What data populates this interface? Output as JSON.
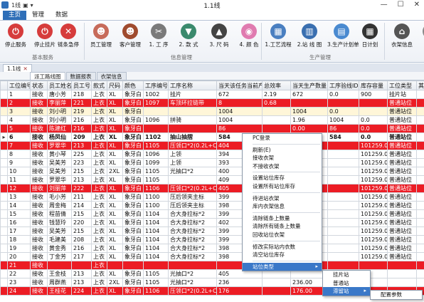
{
  "titlebar": {
    "qa_icon_text": "1线",
    "title": "1.1线",
    "minimize": "—",
    "maximize": "☐",
    "close": "✕"
  },
  "ribbon_tabs": [
    "主页",
    "管理",
    "数据"
  ],
  "ribbon": {
    "groups": {
      "basic": "基本服务",
      "info": "信息管理",
      "production": "生产管理"
    },
    "buttons": [
      {
        "label": "停止服务",
        "icon": "stop-service-icon",
        "color": "#d63c3c",
        "glyph": "⏻"
      },
      {
        "label": "停止挂片",
        "icon": "stop-hanging-icon",
        "color": "#d63c3c",
        "glyph": "⏻"
      },
      {
        "label": "链条急停",
        "icon": "chain-stop-icon",
        "color": "#d63c3c",
        "glyph": "✕"
      },
      {
        "label": "员工管理",
        "icon": "staff-icon",
        "color": "#c76b5a",
        "glyph": "☻"
      },
      {
        "label": "客户管理",
        "icon": "customer-icon",
        "color": "#a04b2e",
        "glyph": "☻"
      },
      {
        "label": "1. 工 序",
        "icon": "process-scissors-icon",
        "color": "#7a7a7a",
        "glyph": "✂"
      },
      {
        "label": "2. 款 式",
        "icon": "style-shirt-icon",
        "color": "#3b8a6d",
        "glyph": "▼"
      },
      {
        "label": "3. 尺 码",
        "icon": "size-icon",
        "color": "#444444",
        "glyph": "▲"
      },
      {
        "label": "4. 颜 色",
        "icon": "color-palette-icon",
        "color": "#e07bb0",
        "glyph": "◉"
      },
      {
        "label": "1.工艺流程",
        "icon": "workflow-icon",
        "color": "#4a7fc1",
        "glyph": "▦"
      },
      {
        "label": "2.站 线 图",
        "icon": "station-map-icon",
        "color": "#3a6fb0",
        "glyph": "▥"
      },
      {
        "label": "3.生产计划单",
        "icon": "plan-icon",
        "color": "#4a8ad0",
        "glyph": "▤"
      },
      {
        "label": "日计划",
        "icon": "calendar-icon",
        "color": "#333333",
        "glyph": "▦"
      },
      {
        "label": "衣架信息",
        "icon": "hanger-icon",
        "color": "#555555",
        "glyph": "⌂"
      },
      {
        "label": "数",
        "icon": "data-icon",
        "color": "#888888",
        "glyph": "▣"
      }
    ]
  },
  "doc_tabs": [
    {
      "label": "1.1线",
      "close": "✕"
    }
  ],
  "sub_tabs": [
    "派工路线图",
    "数据报表",
    "衣架信息"
  ],
  "grid": {
    "columns": [
      "工位编号",
      "状态",
      "员工姓名",
      "员工号",
      "款式",
      "尺码",
      "颜色",
      "工序编号",
      "工序名称",
      "当天该任务当前产量",
      "总效率",
      "当天生产数量",
      "工序验线ID",
      "库存容量",
      "工位类型",
      "其他"
    ],
    "rows": [
      {
        "style": "r-white",
        "ind": "",
        "cells": [
          "1",
          "接收",
          "唐小芳",
          "218",
          "上衣",
          "XL",
          "象牙白",
          "1002",
          "挂片",
          "672",
          "2.19",
          "672",
          "0.0",
          "900",
          "挂片站",
          ""
        ]
      },
      {
        "style": "r-red",
        "ind": "",
        "cells": [
          "2",
          "接收",
          "李丽萍",
          "221",
          "上衣",
          "XL",
          "象牙白",
          "1097",
          "车顶环拉链带",
          "8",
          "0.68",
          "",
          "",
          "",
          "普通站位",
          ""
        ]
      },
      {
        "style": "r-yellow",
        "ind": "",
        "cells": [
          "3",
          "接收",
          "刘小明",
          "219",
          "上衣",
          "XL",
          "象牙白",
          "",
          "",
          "1004",
          "",
          "1004",
          "0.0",
          "",
          "普通站位",
          ""
        ]
      },
      {
        "style": "r-white",
        "ind": "",
        "cells": [
          "4",
          "接收",
          "刘小明",
          "216",
          "上衣",
          "XL",
          "象牙白",
          "1096",
          "拼骑",
          "1004",
          "",
          "1.96",
          "1004",
          "0.0",
          "普通站位",
          ""
        ]
      },
      {
        "style": "r-red",
        "ind": "",
        "cells": [
          "5",
          "接收",
          "陈建红",
          "216",
          "上衣",
          "XL",
          "象牙白",
          "",
          "",
          "86",
          "",
          "0.00",
          "86",
          "0.0",
          "普通站位",
          ""
        ]
      },
      {
        "style": "r-sel",
        "ind": "▸",
        "cells": [
          "6",
          "接收",
          "杨凤仙",
          "209",
          "上衣",
          "XL",
          "象牙白",
          "1102",
          "抽山抽摺",
          "584",
          "",
          "2.04",
          "584",
          "0.0",
          "普通站位",
          ""
        ]
      },
      {
        "style": "r-red",
        "ind": "",
        "cells": [
          "7",
          "接收",
          "罗翠华",
          "213",
          "上衣",
          "XL",
          "象牙白",
          "1105",
          "压领口*2(0.2L+C)",
          "404",
          "",
          "",
          "",
          "101259.0",
          "普通站位",
          ""
        ]
      },
      {
        "style": "r-white",
        "ind": "",
        "cells": [
          "8",
          "接收",
          "黄小琴",
          "225",
          "上衣",
          "XL",
          "象牙白",
          "1096",
          "上领",
          "394",
          "",
          "",
          "",
          "101259.0",
          "普通站位",
          ""
        ]
      },
      {
        "style": "r-white",
        "ind": "",
        "cells": [
          "9",
          "接收",
          "吴美芳",
          "223",
          "上衣",
          "XL",
          "象牙白",
          "1099",
          "上领",
          "393",
          "",
          "",
          "",
          "101259.0",
          "普通站位",
          ""
        ]
      },
      {
        "style": "r-white",
        "ind": "",
        "cells": [
          "10",
          "接收",
          "吴美芳",
          "215",
          "上衣",
          "2XL",
          "象牙白",
          "1105",
          "光抽口*2",
          "400",
          "",
          "",
          "",
          "101259.0",
          "普通站位",
          ""
        ]
      },
      {
        "style": "r-white",
        "ind": "",
        "cells": [
          "11",
          "接收",
          "罗翠华",
          "213",
          "上衣",
          "XL",
          "象牙白",
          "1105",
          "",
          "409",
          "",
          "",
          "",
          "101259.0",
          "普通站位",
          ""
        ]
      },
      {
        "style": "r-red",
        "ind": "",
        "cells": [
          "12",
          "接收",
          "刘丽萍",
          "222",
          "上衣",
          "XL",
          "象牙白",
          "1106",
          "压领口*2(0.2L+C)",
          "405",
          "",
          "",
          "",
          "101259.0",
          "普通站位",
          ""
        ]
      },
      {
        "style": "r-white",
        "ind": "",
        "cells": [
          "13",
          "接收",
          "毛小芳",
          "211",
          "上衣",
          "XL",
          "象牙白",
          "1100",
          "压后领夹主标",
          "399",
          "",
          "",
          "",
          "101259.0",
          "普通站位",
          ""
        ]
      },
      {
        "style": "r-white",
        "ind": "",
        "cells": [
          "14",
          "接收",
          "周金梅",
          "214",
          "上衣",
          "XL",
          "象牙白",
          "1100",
          "压后领夹主标",
          "398",
          "",
          "",
          "",
          "101259.0",
          "普通站位",
          ""
        ]
      },
      {
        "style": "r-white",
        "ind": "",
        "cells": [
          "15",
          "接收",
          "程苗倩",
          "215",
          "上衣",
          "XL",
          "象牙白",
          "1104",
          "合大身拉标*2",
          "399",
          "",
          "",
          "",
          "101259.0",
          "普通站位",
          ""
        ]
      },
      {
        "style": "r-white",
        "ind": "",
        "cells": [
          "16",
          "接收",
          "钱慧玲",
          "220",
          "上衣",
          "XL",
          "象牙白",
          "1104",
          "合大身拉标*2",
          "402",
          "",
          "",
          "",
          "101259.0",
          "普通站位",
          ""
        ]
      },
      {
        "style": "r-white",
        "ind": "",
        "cells": [
          "17",
          "接收",
          "吴美芳",
          "215",
          "上衣",
          "XL",
          "象牙白",
          "1104",
          "合大身拉标*2",
          "399",
          "",
          "",
          "",
          "101259.0",
          "普通站位",
          ""
        ]
      },
      {
        "style": "r-white",
        "ind": "",
        "cells": [
          "18",
          "接收",
          "毛建美",
          "208",
          "上衣",
          "XL",
          "象牙白",
          "1104",
          "合大身拉标*2",
          "399",
          "",
          "",
          "",
          "101259.0",
          "普通站位",
          ""
        ]
      },
      {
        "style": "r-white",
        "ind": "",
        "cells": [
          "19",
          "接收",
          "黄金秀",
          "216",
          "上衣",
          "XL",
          "象牙白",
          "1104",
          "合大身拉标*2",
          "398",
          "",
          "",
          "",
          "101259.0",
          "普通站位",
          ""
        ]
      },
      {
        "style": "r-white",
        "ind": "",
        "cells": [
          "20",
          "接收",
          "丁金芳",
          "217",
          "上衣",
          "XL",
          "象牙白",
          "1104",
          "合大身拉标*2",
          "398",
          "",
          "",
          "",
          "101259.0",
          "普通站位",
          ""
        ]
      },
      {
        "style": "r-red",
        "ind": "",
        "cells": [
          "21",
          "接收",
          "",
          "",
          "上衣",
          "",
          "",
          "",
          "",
          "",
          "",
          "",
          "",
          "",
          "",
          ""
        ]
      },
      {
        "style": "r-white",
        "ind": "",
        "cells": [
          "22",
          "接收",
          "王金枝",
          "213",
          "上衣",
          "XL",
          "象牙白",
          "1105",
          "光抽口*2",
          "405",
          "",
          "",
          "",
          "",
          "",
          ""
        ]
      },
      {
        "style": "r-white",
        "ind": "",
        "cells": [
          "23",
          "接收",
          "周群燕",
          "213",
          "上衣",
          "2XL",
          "象牙白",
          "1105",
          "光抽口*2",
          "236",
          "",
          "236.00",
          "236",
          "",
          "",
          ""
        ]
      },
      {
        "style": "r-red",
        "ind": "",
        "cells": [
          "24",
          "接收",
          "王桂花",
          "224",
          "上衣",
          "XL",
          "象牙白",
          "1106",
          "压领口*2(0.2L+C)",
          "176",
          "",
          "176.00",
          "176",
          "",
          "",
          ""
        ]
      }
    ]
  },
  "context_menu": {
    "items": [
      {
        "label": "PC登录",
        "sep_after": true
      },
      {
        "label": "刷新(E)"
      },
      {
        "label": "接收衣架"
      },
      {
        "label": "不接收衣架",
        "sep_after": true
      },
      {
        "label": "设置站位库存"
      },
      {
        "label": "设置所有站位库存",
        "sep_after": true
      },
      {
        "label": "待进站衣架"
      },
      {
        "label": "库内衣架信息",
        "sep_after": true
      },
      {
        "label": "清除链条上数量"
      },
      {
        "label": "清除所有链条上数量"
      },
      {
        "label": "回收站位衣架",
        "sep_after": true
      },
      {
        "label": "修改实际站内衣数"
      },
      {
        "label": "清空站位库存",
        "sep_after": true
      },
      {
        "label": "站位类型",
        "submenu": true,
        "highlight": true
      }
    ],
    "submenu": [
      {
        "label": "挂片站"
      },
      {
        "label": "普通站"
      },
      {
        "label": "滞留站",
        "submenu": true,
        "highlight": true
      }
    ],
    "submenu2": [
      {
        "label": "配置参数"
      }
    ]
  }
}
